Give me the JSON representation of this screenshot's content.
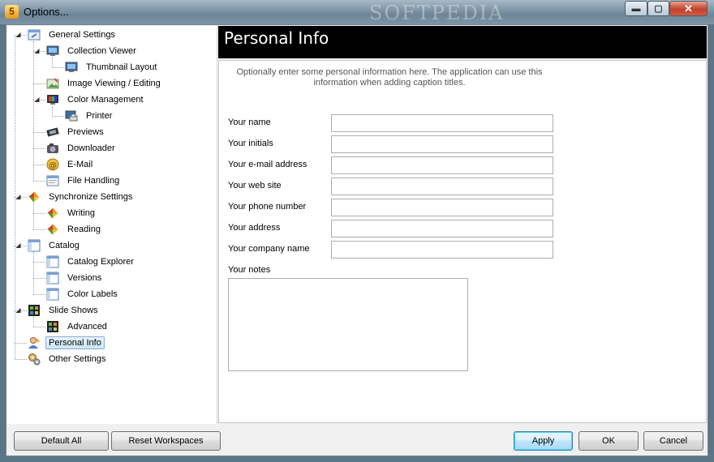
{
  "window": {
    "title": "Options...",
    "app_icon_letter": "5",
    "watermark": "SOFTPEDIA",
    "min_glyph": "▬",
    "max_glyph": "▢",
    "close_glyph": "✕"
  },
  "tree": {
    "items": [
      {
        "label": "General Settings",
        "icon": "settings-window-icon",
        "expander": "◢"
      },
      {
        "label": "Collection Viewer",
        "icon": "monitor-icon",
        "expander": "◢"
      },
      {
        "label": "Thumbnail Layout",
        "icon": "monitor-icon"
      },
      {
        "label": "Image Viewing / Editing",
        "icon": "image-edit-icon"
      },
      {
        "label": "Color Management",
        "icon": "color-monitor-icon",
        "expander": "◢"
      },
      {
        "label": "Printer",
        "icon": "printer-monitor-icon"
      },
      {
        "label": "Previews",
        "icon": "film-icon"
      },
      {
        "label": "Downloader",
        "icon": "camera-icon"
      },
      {
        "label": "E-Mail",
        "icon": "email-icon"
      },
      {
        "label": "File Handling",
        "icon": "file-window-icon"
      },
      {
        "label": "Synchronize Settings",
        "icon": "sync-icon",
        "expander": "◢"
      },
      {
        "label": "Writing",
        "icon": "sync-icon"
      },
      {
        "label": "Reading",
        "icon": "sync-icon"
      },
      {
        "label": "Catalog",
        "icon": "catalog-icon",
        "expander": "◢"
      },
      {
        "label": "Catalog Explorer",
        "icon": "catalog-icon"
      },
      {
        "label": "Versions",
        "icon": "catalog-icon"
      },
      {
        "label": "Color Labels",
        "icon": "catalog-icon"
      },
      {
        "label": "Slide Shows",
        "icon": "slideshow-icon",
        "expander": "◢"
      },
      {
        "label": "Advanced",
        "icon": "slideshow-icon"
      },
      {
        "label": "Personal Info",
        "icon": "person-icon",
        "selected": true
      },
      {
        "label": "Other Settings",
        "icon": "gears-icon"
      }
    ]
  },
  "panel": {
    "title": "Personal Info",
    "intro": "Optionally enter some personal information here. The application can use this information when adding caption titles.",
    "fields": [
      {
        "label": "Your name",
        "value": ""
      },
      {
        "label": "Your initials",
        "value": ""
      },
      {
        "label": "Your e-mail address",
        "value": ""
      },
      {
        "label": "Your web site",
        "value": ""
      },
      {
        "label": "Your phone number",
        "value": ""
      },
      {
        "label": "Your address",
        "value": ""
      },
      {
        "label": "Your company name",
        "value": ""
      }
    ],
    "notes": {
      "label": "Your notes",
      "value": ""
    }
  },
  "buttons": {
    "default_all": "Default All",
    "reset_workspaces": "Reset Workspaces",
    "apply": "Apply",
    "ok": "OK",
    "cancel": "Cancel"
  },
  "colors": {
    "header_bg": "#000000",
    "header_text": "#ffffff",
    "selection": "#cde6fb"
  }
}
